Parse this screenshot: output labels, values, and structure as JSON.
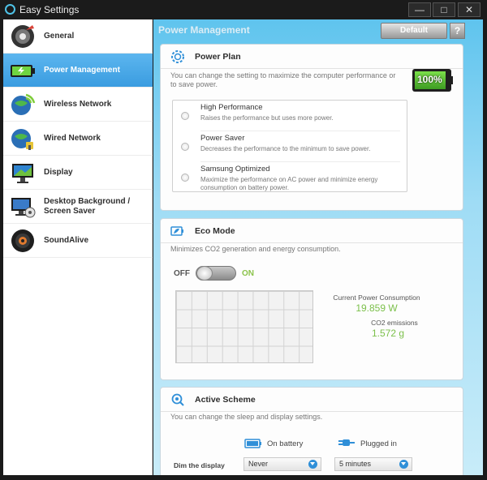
{
  "window": {
    "title": "Easy Settings",
    "buttons": {
      "minimize": "—",
      "maximize": "□",
      "close": "✕"
    }
  },
  "sidebar": {
    "items": [
      {
        "label": "General",
        "icon": "general-icon",
        "active": false
      },
      {
        "label": "Power Management",
        "icon": "battery-icon",
        "active": true
      },
      {
        "label": "Wireless Network",
        "icon": "wireless-globe-icon",
        "active": false
      },
      {
        "label": "Wired Network",
        "icon": "wired-globe-icon",
        "active": false
      },
      {
        "label": "Display",
        "icon": "monitor-icon",
        "active": false
      },
      {
        "label": "Desktop Background /",
        "label2": "Screen Saver",
        "icon": "desktop-icon",
        "active": false
      },
      {
        "label": "SoundAlive",
        "icon": "speaker-icon",
        "active": false
      }
    ]
  },
  "header": {
    "title": "Power Management",
    "default_label": "Default",
    "help_label": "?"
  },
  "power_plan": {
    "title": "Power Plan",
    "desc": "You can change the setting to maximize the computer performance or to save power.",
    "battery_percent": "100%",
    "battery_level": 1.0,
    "options": [
      {
        "name": "High Performance",
        "desc": "Raises the performance but uses more power."
      },
      {
        "name": "Power Saver",
        "desc": "Decreases the performance to the minimum to save power."
      },
      {
        "name": "Samsung Optimized",
        "desc": "Maximize the performance on AC power and minimize energy consumption on battery power."
      }
    ]
  },
  "eco_mode": {
    "title": "Eco Mode",
    "desc": "Minimizes CO2 generation and energy consumption.",
    "off_label": "OFF",
    "on_label": "ON",
    "state": "off",
    "current_power_label": "Current Power Consumption",
    "current_power_value": "19.859 W",
    "co2_label": "CO2 emissions",
    "co2_value": "1.572 g"
  },
  "active_scheme": {
    "title": "Active Scheme",
    "desc": "You can change the sleep and display settings.",
    "on_battery_label": "On battery",
    "plugged_in_label": "Plugged in",
    "dim_label": "Dim the display",
    "dim_battery_value": "Never",
    "dim_plugged_value": "5 minutes"
  },
  "colors": {
    "accent": "#3a9ce0",
    "eco_green": "#7cc04b",
    "content_bg": "#5fc4ee"
  }
}
